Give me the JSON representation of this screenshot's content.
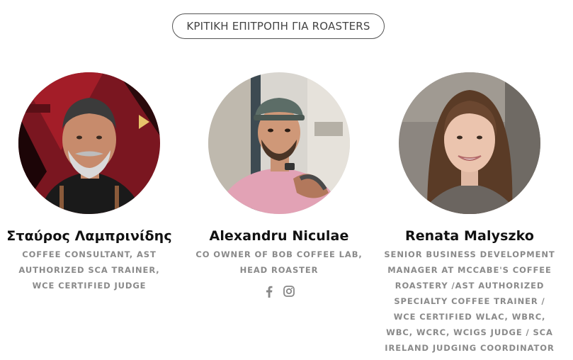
{
  "section": {
    "title": "ΚΡΙΤΙΚΗ ΕΠΙΤΡΟΠΗ ΓΙΑ ROASTERS"
  },
  "members": [
    {
      "name": "Σταύρος Λαμπρινίδης",
      "role": "Coffee Consultant, AST Authorized SCA Trainer, WCE Certified Judge"
    },
    {
      "name": "Alexandru Niculae",
      "role": "Co Owner of Bob Coffee Lab, Head Roaster",
      "socials": [
        {
          "icon": "facebook-icon"
        },
        {
          "icon": "instagram-icon"
        }
      ]
    },
    {
      "name": "Renata Malyszko",
      "role": "Senior Business Development Manager at McCabe's Coffee Roastery /AST Authorized Specialty Coffee Trainer / WCE Certified WLAC, WBrC, WBC, WCRC, WCIGS Judge / SCA Ireland Judging Coordinator"
    }
  ],
  "colors": {
    "badge_border": "#555555",
    "name_text": "#111111",
    "role_text": "#8a8a8a",
    "social_icon": "#888888"
  }
}
